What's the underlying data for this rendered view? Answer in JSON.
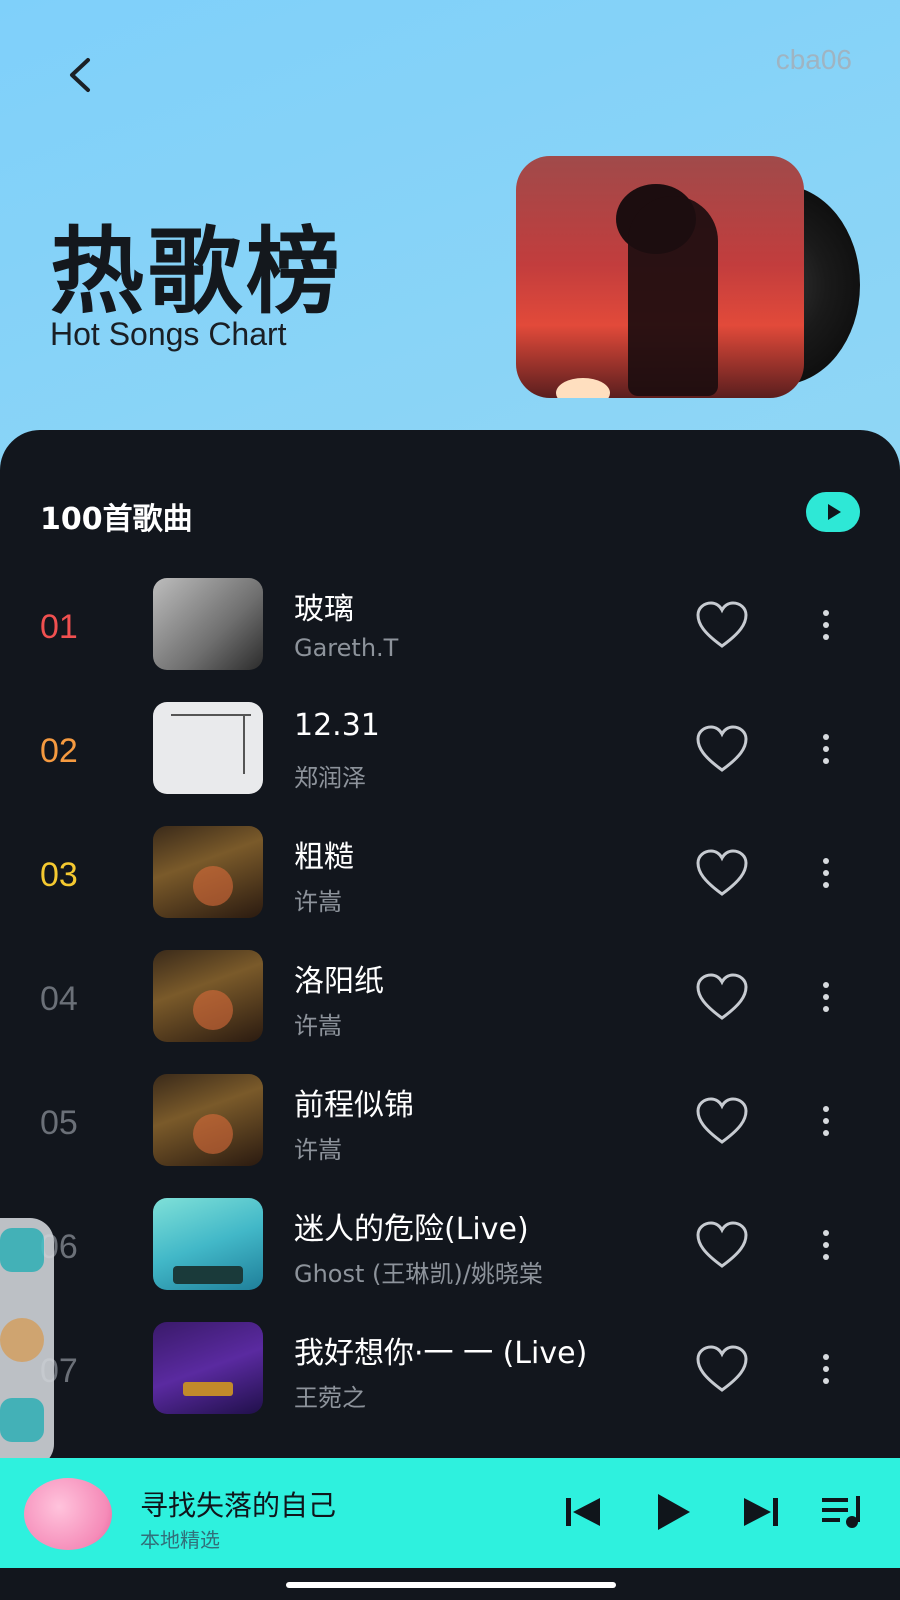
{
  "header": {
    "user_id": "cba06",
    "title": "热歌榜",
    "subtitle": "Hot Songs Chart"
  },
  "list": {
    "count_label": "100首歌曲",
    "songs": [
      {
        "rank": "01",
        "title": "玻璃",
        "artist": "Gareth.T",
        "rank_color": "#f05050"
      },
      {
        "rank": "02",
        "title": "12.31",
        "artist": "郑润泽",
        "rank_color": "#f59a40"
      },
      {
        "rank": "03",
        "title": "粗糙",
        "artist": "许嵩",
        "rank_color": "#f5c930"
      },
      {
        "rank": "04",
        "title": "洛阳纸",
        "artist": "许嵩",
        "rank_color": "#6b7078"
      },
      {
        "rank": "05",
        "title": "前程似锦",
        "artist": "许嵩",
        "rank_color": "#6b7078"
      },
      {
        "rank": "06",
        "title": "迷人的危险(Live)",
        "artist": "Ghost (王琳凯)/姚晓棠",
        "rank_color": "#6b7078"
      },
      {
        "rank": "07",
        "title": "我好想你·一 一 (Live)",
        "artist": "王菀之",
        "rank_color": "#6b7078"
      }
    ]
  },
  "player": {
    "title": "寻找失落的自己",
    "subtitle": "本地精选"
  },
  "colors": {
    "accent": "#2ef1de",
    "panel": "#12161d"
  }
}
